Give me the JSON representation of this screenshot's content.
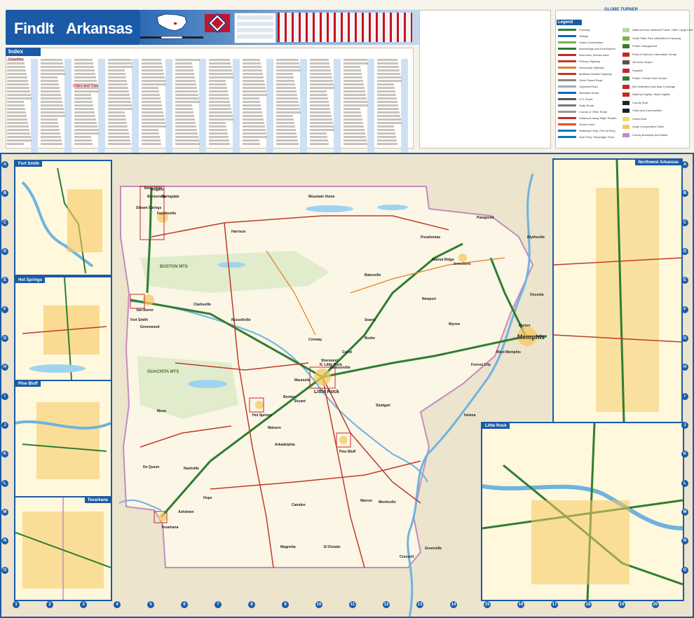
{
  "header": {
    "brand": "FindIt",
    "state": "Arkansas",
    "publisher": "GLOBE TURNER"
  },
  "index": {
    "title": "Index",
    "counties_label": "Counties",
    "cities_label": "Cities and Towns"
  },
  "legend": {
    "title": "Legend",
    "items": [
      {
        "label": "Freeway",
        "color": "#2e7d32"
      },
      {
        "label": "Tollway",
        "color": "#1565c0"
      },
      {
        "label": "Under Construction",
        "color": "#7cb342"
      },
      {
        "label": "Interchange and Exit Number",
        "color": "#2e7d32"
      },
      {
        "label": "Rest Area, Service Area",
        "color": "#c62828"
      },
      {
        "label": "Primary Highway",
        "color": "#c0392b"
      },
      {
        "label": "Secondary Highway",
        "color": "#e67e22"
      },
      {
        "label": "Multilane Divided Highway",
        "color": "#c0392b"
      },
      {
        "label": "Other Paved Road",
        "color": "#888888"
      },
      {
        "label": "Unpaved Road",
        "color": "#aaaaaa"
      },
      {
        "label": "Interstate Route",
        "color": "#1565c0"
      },
      {
        "label": "U.S. Route",
        "color": "#555555"
      },
      {
        "label": "State Route",
        "color": "#777777"
      },
      {
        "label": "County or Other Route",
        "color": "#999999"
      },
      {
        "label": "Distances along Major Routes",
        "color": "#c62828"
      },
      {
        "label": "Scenic Drive",
        "color": "#e65100"
      },
      {
        "label": "Waterside Stop, Port of Entry",
        "color": "#0277bd"
      },
      {
        "label": "Auto Ferry, Passenger Ferry",
        "color": "#0277bd"
      }
    ],
    "right_items": [
      {
        "label": "National Park, National Forest, Other Large Park",
        "color": "#b9d8a0"
      },
      {
        "label": "Small State Park with/without Camping",
        "color": "#7cb342"
      },
      {
        "label": "Public Campground",
        "color": "#2e7d32"
      },
      {
        "label": "Point of Interest, Information Center",
        "color": "#c62828"
      },
      {
        "label": "Ski Area, Airport",
        "color": "#555555"
      },
      {
        "label": "Hospital",
        "color": "#c62828"
      },
      {
        "label": "Public / Private Golf Course",
        "color": "#2e7d32"
      },
      {
        "label": "Box Indicates Inset Map Coverage",
        "color": "#c62828"
      },
      {
        "label": "National Capital, State Capital",
        "color": "#c62828"
      },
      {
        "label": "County Seat",
        "color": "#222222"
      },
      {
        "label": "Cities and Communities",
        "color": "#222222"
      },
      {
        "label": "Urban Area",
        "color": "#f7d774"
      },
      {
        "label": "Large Incorporated Cities",
        "color": "#f6c85f"
      },
      {
        "label": "County Boundary and Name",
        "color": "#c48bc0"
      }
    ]
  },
  "insets": [
    {
      "title": "Fort Smith"
    },
    {
      "title": "Hot Springs"
    },
    {
      "title": "Pine Bluff"
    },
    {
      "title": "Texarkana"
    },
    {
      "title": "Northwest Arkansas"
    },
    {
      "title": "Little Rock"
    }
  ],
  "cities": [
    {
      "name": "Little Rock"
    },
    {
      "name": "N. Little Rock"
    },
    {
      "name": "Memphis"
    },
    {
      "name": "Fort Smith"
    },
    {
      "name": "Fayetteville"
    },
    {
      "name": "Springdale"
    },
    {
      "name": "Rogers"
    },
    {
      "name": "Jonesboro"
    },
    {
      "name": "Texarkana"
    },
    {
      "name": "Pine Bluff"
    },
    {
      "name": "Hot Springs"
    },
    {
      "name": "Conway"
    },
    {
      "name": "Searcy"
    },
    {
      "name": "West Memphis"
    },
    {
      "name": "El Dorado"
    },
    {
      "name": "Russellville"
    },
    {
      "name": "Batesville"
    },
    {
      "name": "Harrison"
    },
    {
      "name": "Mountain Home"
    },
    {
      "name": "Paragould"
    },
    {
      "name": "Stuttgart"
    },
    {
      "name": "Arkadelphia"
    },
    {
      "name": "Magnolia"
    },
    {
      "name": "Camden"
    },
    {
      "name": "Monticello"
    },
    {
      "name": "Helena"
    },
    {
      "name": "Greenville"
    },
    {
      "name": "Bentonville"
    },
    {
      "name": "Bella Vista"
    },
    {
      "name": "Jacksonville"
    },
    {
      "name": "Sherwood"
    },
    {
      "name": "Maumelle"
    },
    {
      "name": "Bryant"
    },
    {
      "name": "Benton"
    },
    {
      "name": "Malvern"
    },
    {
      "name": "Hope"
    },
    {
      "name": "Mena"
    },
    {
      "name": "Clarksville"
    },
    {
      "name": "Blytheville"
    },
    {
      "name": "Forrest City"
    },
    {
      "name": "Wynne"
    },
    {
      "name": "Marion"
    },
    {
      "name": "Osceola"
    },
    {
      "name": "Siloam Springs"
    },
    {
      "name": "Van Buren"
    },
    {
      "name": "Greenwood"
    },
    {
      "name": "Cabot"
    },
    {
      "name": "Beebe"
    },
    {
      "name": "Newport"
    },
    {
      "name": "Walnut Ridge"
    },
    {
      "name": "Pocahontas"
    },
    {
      "name": "Crossett"
    },
    {
      "name": "Warren"
    },
    {
      "name": "De Queen"
    },
    {
      "name": "Nashville"
    },
    {
      "name": "Ashdown"
    }
  ],
  "grid": {
    "columns": [
      "1",
      "2",
      "3",
      "4",
      "5",
      "6",
      "7",
      "8",
      "9",
      "10",
      "11",
      "12",
      "13",
      "14",
      "15",
      "16",
      "17",
      "18",
      "19",
      "20"
    ],
    "rows": [
      "A",
      "B",
      "C",
      "D",
      "E",
      "F",
      "G",
      "H",
      "I",
      "J",
      "K",
      "L",
      "M",
      "N",
      "O"
    ]
  },
  "regions": [
    "BOSTON MTS",
    "OUACHITA MTS"
  ]
}
